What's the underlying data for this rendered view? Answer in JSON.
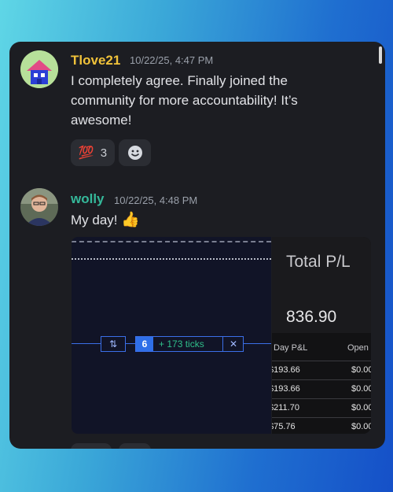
{
  "messages": [
    {
      "username": "Tlove21",
      "username_color": "#f0c23a",
      "timestamp": "10/22/25, 4:47 PM",
      "lines": [
        "I completely agree. Finally joined the",
        "community for more accountability! It’s",
        "awesome!"
      ],
      "reaction": {
        "emoji": "💯",
        "count": "3"
      }
    },
    {
      "username": "wolly",
      "username_color": "#35b89a",
      "timestamp": "10/22/25, 4:48 PM",
      "text": "My day!",
      "emoji": "👍"
    }
  ],
  "trading": {
    "order_arrow": "⇅",
    "order_qty": "6",
    "order_ticks": "+ 173 ticks",
    "order_close": "✕",
    "total_pl_label": "Total P/L",
    "total_pl_value": "836.90",
    "columns": [
      "Day P&L",
      "Open P"
    ],
    "rows": [
      {
        "day": "$193.66",
        "open": "$0.00"
      },
      {
        "day": "$193.66",
        "open": "$0.00"
      },
      {
        "day": "$211.70",
        "open": "$0.00"
      },
      {
        "day": "$75.76",
        "open": "$0.00"
      }
    ]
  },
  "icons": {
    "add_reaction": "smiley-icon",
    "scroll": "scrollbar"
  }
}
